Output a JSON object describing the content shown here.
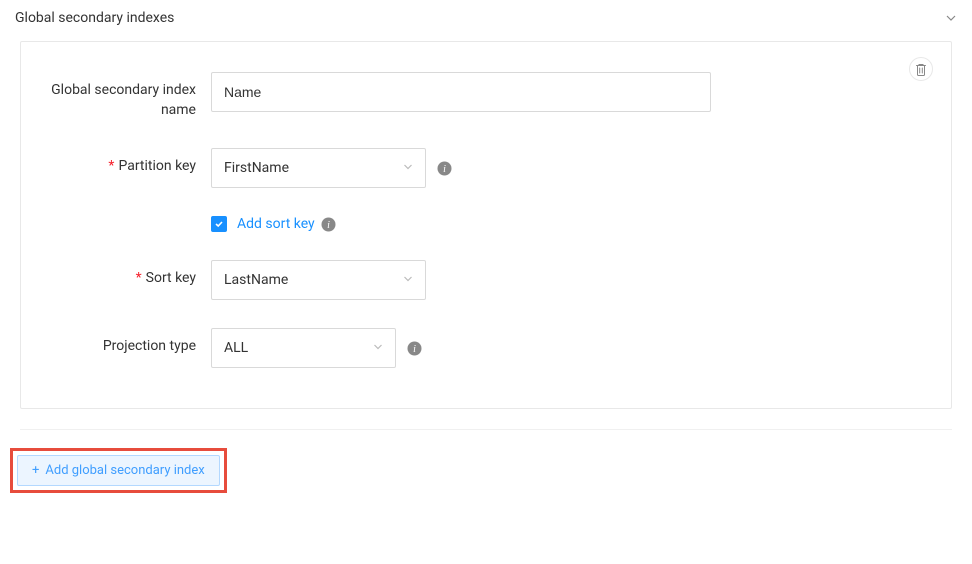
{
  "section": {
    "title": "Global secondary indexes"
  },
  "index": {
    "name_label": "Global secondary index name",
    "name_value": "Name",
    "partition_key_label": "Partition key",
    "partition_key_value": "FirstName",
    "add_sort_key_label": "Add sort key",
    "add_sort_key_checked": "true",
    "sort_key_label": "Sort key",
    "sort_key_value": "LastName",
    "projection_type_label": "Projection type",
    "projection_type_value": "ALL"
  },
  "buttons": {
    "add_index": "Add global secondary index"
  }
}
